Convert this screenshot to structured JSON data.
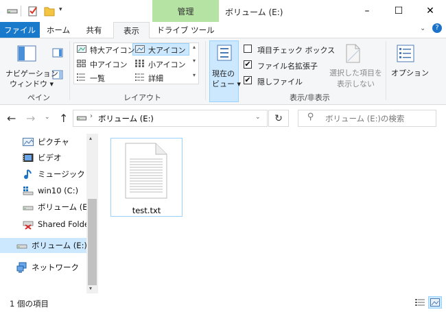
{
  "window": {
    "title": "ボリューム (E:)",
    "context_tab": "管理",
    "controls": {
      "minimize": "–",
      "maximize": "☐",
      "close": "✕"
    }
  },
  "tabs": {
    "file": "ファイル",
    "home": "ホーム",
    "share": "共有",
    "view": "表示",
    "drive_tools": "ドライブ ツール"
  },
  "ribbon": {
    "pane": {
      "nav_pane_line1": "ナビゲーション",
      "nav_pane_line2": "ウィンドウ ▾",
      "group_label": "ペイン"
    },
    "layout": {
      "extra_large_icons": "特大アイコン",
      "large_icons": "大アイコン",
      "medium_icons": "中アイコン",
      "small_icons": "小アイコン",
      "list": "一覧",
      "details": "詳細",
      "group_label": "レイアウト"
    },
    "current_view": {
      "line1": "現在の",
      "line2": "ビュー ▾"
    },
    "show_hide": {
      "item_checkboxes": "項目チェック ボックス",
      "item_checkboxes_checked": false,
      "file_extensions": "ファイル名拡張子",
      "file_extensions_checked": true,
      "hidden_items": "隠しファイル",
      "hidden_items_checked": true,
      "hide_selected_line1": "選択した項目を",
      "hide_selected_line2": "表示しない",
      "group_label": "表示/非表示"
    },
    "options": "オプション"
  },
  "navigation": {
    "address": "ボリューム (E:)",
    "search_placeholder": "ボリューム (E:)の検索"
  },
  "sidebar": {
    "items": [
      {
        "label": "ピクチャ",
        "icon": "pictures-icon"
      },
      {
        "label": "ビデオ",
        "icon": "videos-icon"
      },
      {
        "label": "ミュージック",
        "icon": "music-icon"
      },
      {
        "label": "win10 (C:)",
        "icon": "drive-c-icon"
      },
      {
        "label": "ボリューム (E:)",
        "icon": "drive-e-icon"
      },
      {
        "label": "Shared Folder",
        "icon": "shared-folder-icon"
      }
    ],
    "selected": {
      "label": "ボリューム (E:)"
    },
    "network": {
      "label": "ネットワーク"
    }
  },
  "content": {
    "files": [
      {
        "name": "test.txt"
      }
    ]
  },
  "status": {
    "item_count": "1 個の項目"
  },
  "colors": {
    "file_tab": "#1979ca",
    "context_tab": "#b5e3a3",
    "accent": "#0078d7"
  }
}
